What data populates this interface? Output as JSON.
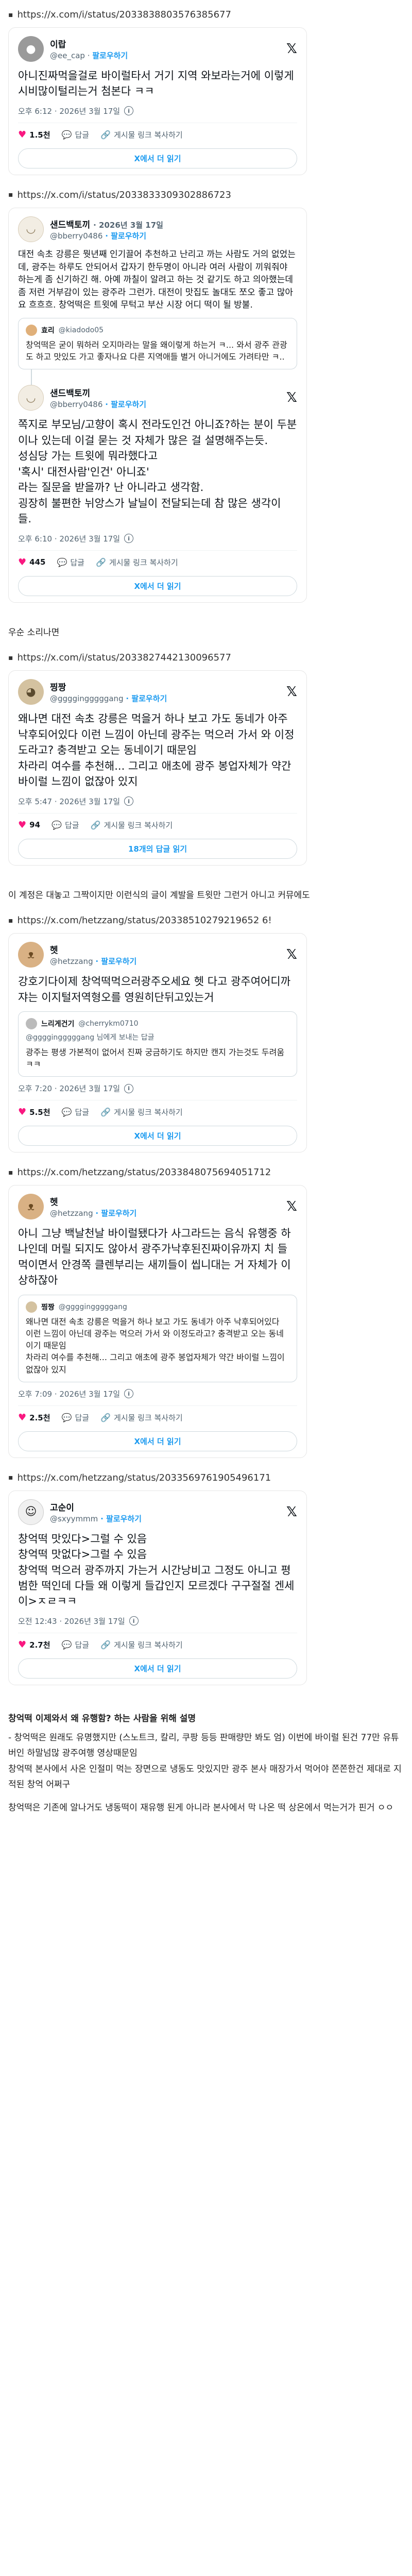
{
  "post1": {
    "url": "https://x.com/i/status/2033838803576385677",
    "name": "이랍",
    "handle": "@ee_cap",
    "follow": "팔로우하기",
    "body": "아니진짜먹을걸로 바이럴타서 거기 지역 와보라는거에 이렇게 시비많이털리는거 첨본다 ㅋㅋ",
    "meta": "오후 6:12 · 2026년 3월 17일",
    "likes": "1.5천",
    "reply": "답글",
    "copy": "게시물 링크 복사하기",
    "more": "X에서 더 읽기"
  },
  "post2": {
    "url": "https://x.com/i/status/2033833309302886723",
    "quoted_name": "샌드백토끼",
    "quoted_meta": "· 2026년 3월 17일",
    "quoted_handle": "@bberry0486",
    "quoted_follow": "· 팔로우하기",
    "quoted_body": "대전 속초 강릉은 뭣년째 인기끌어 추천하고 난리고 까는 사람도 거의 없었는데, 광주는 하루도 안되어서 갑자기 한두명이 아니라 여러 사람이 끼워줘야 하는게 좀 신기하긴 해. 아예 까칠이 알려고 하는 것 같기도 하고 의아했는데 좀 저런 거부감이 있는 광주라 그런가. 대전이 맛집도 놀대도 쪼오 좋고 많아요 흐흐흐. 창억떡은 트윗에 무턱고 부산 시장 어디 떡이 될 방불.",
    "inner_name": "효리",
    "inner_handle": "@kiadodo05",
    "inner_body": "창억떡은 굳이 뭐하러 오지마라는 말을 왜이렇게 하는거 ㅋ... 와서 광주 관광도 하고 맛있도 가고 좋자나요 다른 지역애들 별거 아니거에도 가려타만 ㅋ..",
    "reply_name": "샌드백토끼",
    "reply_handle": "@bberry0486",
    "reply_follow": "· 팔로우하기",
    "body": "쪽지로 부모님/고향이 혹시 전라도인건 아니죠?하는 분이 두분이나 있는데 이걸 묻는 것 자체가 많은 걸 설명해주는듯.\n성심당 가는 트윗에 뭐라했다고\n'혹시' 대전사람'인건' 아니죠'\n라는 질문을 받을까? 난 아니라고 생각함.\n굉장히 불편한 뉘앙스가 날닐이 전달되는데 참 많은 생각이 들.",
    "meta": "오후 6:10 · 2026년 3월 17일",
    "likes": "445",
    "reply": "답글",
    "copy": "게시물 링크 복사하기",
    "more": "X에서 더 읽기"
  },
  "between1": "우순 소리나면",
  "post3": {
    "url": "https://x.com/i/status/2033827442130096577",
    "name": "찡짱",
    "handle": "@ggggingggggang",
    "follow": "· 팔로우하기",
    "body": "왜나면 대전 속초 강릉은 먹을거 하나 보고 가도 동네가 아주 낙후되어있다 이런 느낌이 아닌데 광주는 먹으러 가서 와 이정도라고? 충격받고 오는 동네이기 때문임\n차라리 여수를 추천해... 그리고 애초에 광주 봉업자체가 약간 바이럴 느낌이 없잖아 있지",
    "meta": "오후 5:47 · 2026년 3월 17일",
    "likes": "94",
    "reply": "답글",
    "copy": "게시물 링크 복사하기",
    "more": "18개의 답글 읽기"
  },
  "between2": "이 계정은 대놓고 그짝이지만 이런식의 글이 계발을 트윗만 그런거 아니고 커뮤에도",
  "post4": {
    "url": "https://x.com/hetzzang/status/20338510279219652 6!",
    "name": "헷",
    "handle": "@hetzzang",
    "follow": "· 팔로우하기",
    "body": "강호기다이제 창억떡먹으러광주오세요 헷 다고 광주여어디까쟈는 이지털저역형오를 영원히단뒤고있는거",
    "quote_name": "느리게건기",
    "quote_handle": "@cherrykm0710",
    "quote_reply": "@ggggingggggang 님에게 보내는 답글",
    "quote_body": "광주는 평생 가본적이 없어서 진짜 궁금하기도 하지만 캔지 가는것도 두려움 ㅋㅋ",
    "meta": "오후 7:20 · 2026년 3월 17일",
    "likes": "5.5천",
    "reply": "답글",
    "copy": "게시물 링크 복사하기",
    "more": "X에서 더 읽기"
  },
  "post5": {
    "url": "https://x.com/hetzzang/status/2033848075694051712",
    "name": "헷",
    "handle": "@hetzzang",
    "follow": "· 팔로우하기",
    "body": "아니 그냥 백날천날 바이럴됐다가 사그라드는 음식 유행중 하나인데 머릴 되지도 않아서 광주가낙후된진짜이유까지 치 들먹이면서 안경쪽 클렌부리는 새끼들이 씹니대는 거 자체가 이상하잖아",
    "quote_name": "찡짱",
    "quote_handle": "@ggggingggggang",
    "quote_body": "왜나면 대전 속초 강릉은 먹을거 하나 보고 가도 동네가 아주 낙후되어있다 이런 느낌이 아닌데 광주는 먹으러 가서 와 이정도라고? 충격받고 오는 동네이기 때문임\n차라리 여수를 추천해... 그리고 애초에 광주 봉업자체가 약간 바이럴 느낌이 없잖아 있지",
    "meta": "오후 7:09 · 2026년 3월 17일",
    "likes": "2.5천",
    "reply": "답글",
    "copy": "게시물 링크 복사하기",
    "more": "X에서 더 읽기"
  },
  "post6": {
    "url": "https://x.com/hetzzang/status/2033569761905496171",
    "name": "고순이",
    "handle": "@sxyymmm",
    "follow": "· 팔로우하기",
    "body": "창억떡 맛있다>그럴 수 있음\n창억떡 맛없다>그럴 수 있음\n창억떡 먹으러 광주까지 가는거 시간낭비고 그정도 아니고 평범한 떡인데 다들 왜 이렇게 들갑인지 모르겠다 구구절절 겐세이>ㅈㄹㅋㅋ",
    "meta": "오전 12:43 · 2026년 3월 17일",
    "likes": "2.7천",
    "reply": "답글",
    "copy": "게시물 링크 복사하기",
    "more": "X에서 더 읽기"
  },
  "footer": {
    "title": "창억떡 이제와서 왜 유행함? 하는 사람을 위해 설명",
    "body": "- 창억떡은 원래도 유명했지만 (스노트크, 칼리, 쿠팡 등등 판매량만 봐도 엄) 이번에 바이럴 된건 77만 유튜버인 하말넘많 광주여행 영상때문임\n창억떡 본사에서 사온 인절미 먹는 장면으로 냉동도 맛있지만 광주 본사 매장가서 먹어야 쫀쫀한건 제대로 지적된 창억 어쩌구"
  },
  "footer2": "창억떡은 기존에 알나거도 냉동떡이 재유행 된게 아니라 본사에서 막 나온 떡 상온에서 먹는거가 핀거 ㅇㅇ"
}
